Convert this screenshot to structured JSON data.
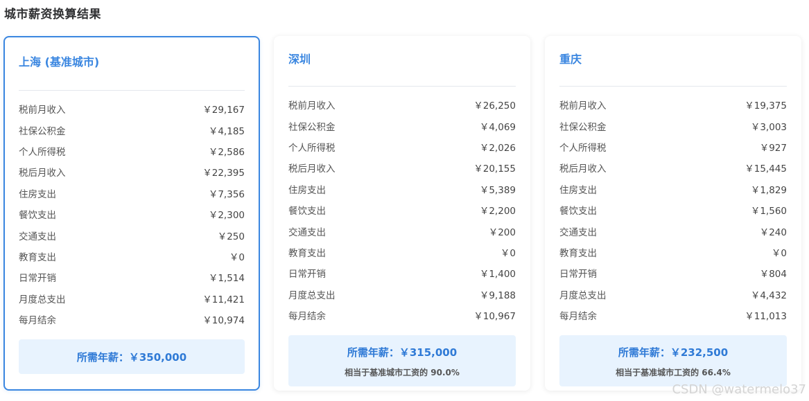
{
  "title": "城市薪资换算结果",
  "cards": [
    {
      "city": "上海 (基准城市)",
      "rows": [
        {
          "label": "税前月收入",
          "value": "￥29,167"
        },
        {
          "label": "社保公积金",
          "value": "￥4,185"
        },
        {
          "label": "个人所得税",
          "value": "￥2,586"
        },
        {
          "label": "税后月收入",
          "value": "￥22,395"
        },
        {
          "label": "住房支出",
          "value": "￥7,356"
        },
        {
          "label": "餐饮支出",
          "value": "￥2,300"
        },
        {
          "label": "交通支出",
          "value": "￥250"
        },
        {
          "label": "教育支出",
          "value": "￥0"
        },
        {
          "label": "日常开销",
          "value": "￥1,514"
        },
        {
          "label": "月度总支出",
          "value": "￥11,421"
        },
        {
          "label": "每月结余",
          "value": "￥10,974"
        }
      ],
      "salary": "所需年薪：￥350,000",
      "ratio": ""
    },
    {
      "city": "深圳",
      "rows": [
        {
          "label": "税前月收入",
          "value": "￥26,250"
        },
        {
          "label": "社保公积金",
          "value": "￥4,069"
        },
        {
          "label": "个人所得税",
          "value": "￥2,026"
        },
        {
          "label": "税后月收入",
          "value": "￥20,155"
        },
        {
          "label": "住房支出",
          "value": "￥5,389"
        },
        {
          "label": "餐饮支出",
          "value": "￥2,200"
        },
        {
          "label": "交通支出",
          "value": "￥200"
        },
        {
          "label": "教育支出",
          "value": "￥0"
        },
        {
          "label": "日常开销",
          "value": "￥1,400"
        },
        {
          "label": "月度总支出",
          "value": "￥9,188"
        },
        {
          "label": "每月结余",
          "value": "￥10,967"
        }
      ],
      "salary": "所需年薪：￥315,000",
      "ratio": "相当于基准城市工资的 90.0%"
    },
    {
      "city": "重庆",
      "rows": [
        {
          "label": "税前月收入",
          "value": "￥19,375"
        },
        {
          "label": "社保公积金",
          "value": "￥3,003"
        },
        {
          "label": "个人所得税",
          "value": "￥927"
        },
        {
          "label": "税后月收入",
          "value": "￥15,445"
        },
        {
          "label": "住房支出",
          "value": "￥1,829"
        },
        {
          "label": "餐饮支出",
          "value": "￥1,560"
        },
        {
          "label": "交通支出",
          "value": "￥240"
        },
        {
          "label": "教育支出",
          "value": "￥0"
        },
        {
          "label": "日常开销",
          "value": "￥804"
        },
        {
          "label": "月度总支出",
          "value": "￥4,432"
        },
        {
          "label": "每月结余",
          "value": "￥11,013"
        }
      ],
      "salary": "所需年薪：￥232,500",
      "ratio": "相当于基准城市工资的 66.4%"
    }
  ],
  "watermark": "CSDN @watermelo37"
}
